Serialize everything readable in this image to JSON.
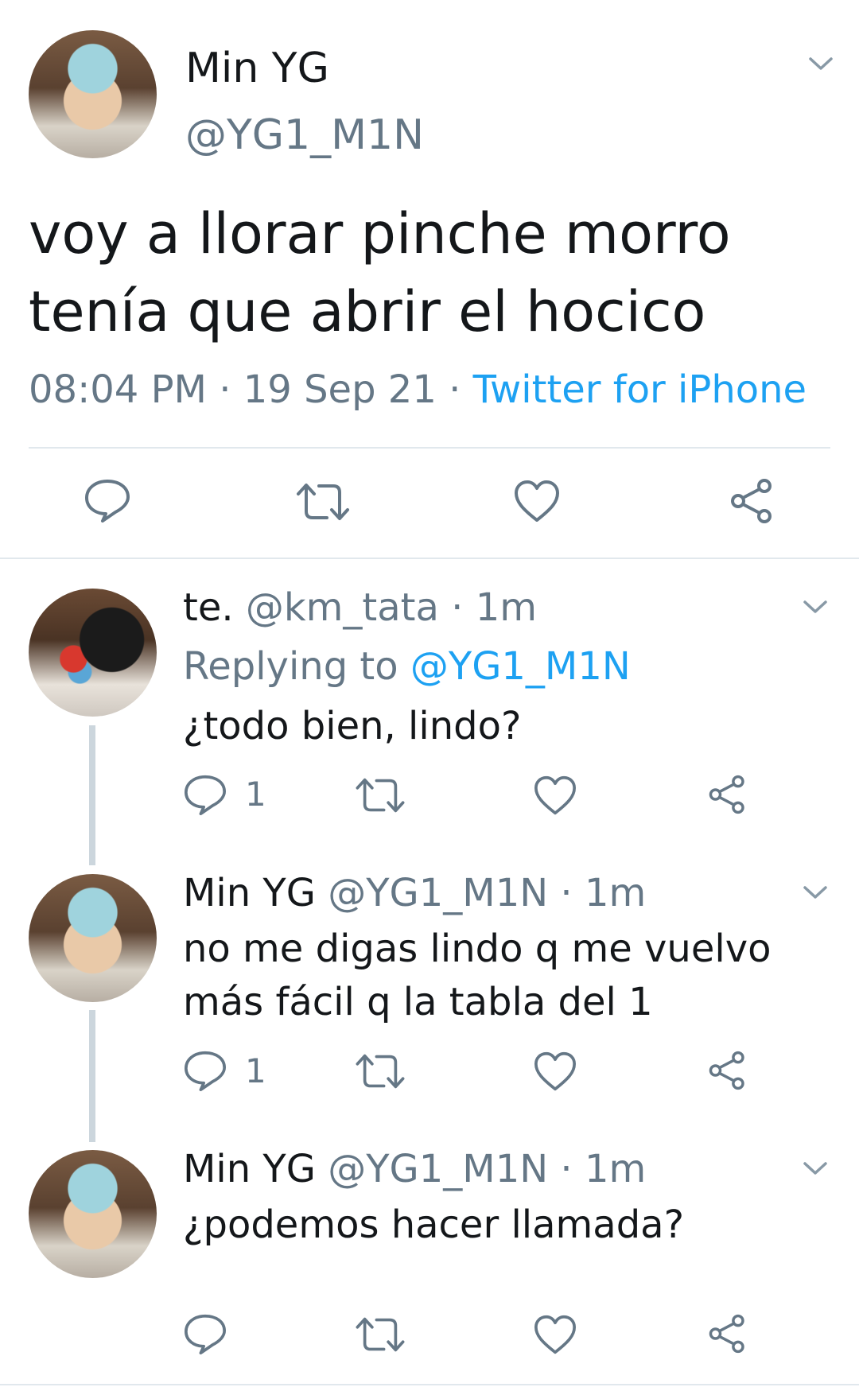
{
  "main_tweet": {
    "display_name": "Min YG",
    "handle": "@YG1_M1N",
    "text_line1": "voy a llorar pinche morro",
    "text_line2": "tenía que abrir el hocico",
    "time": "08:04 PM",
    "date": "19 Sep 21",
    "source": "Twitter for iPhone",
    "separator": " · "
  },
  "replies": [
    {
      "display_name": "te.",
      "handle": "@km_tata",
      "age": "1m",
      "replying_label": "Replying to",
      "replying_to": "@YG1_M1N",
      "text_line1": "¿todo bien, lindo?",
      "reply_count": "1"
    },
    {
      "display_name": "Min YG",
      "handle": "@YG1_M1N",
      "age": "1m",
      "text_line1": "no me digas lindo q me vuelvo",
      "text_line2": "más fácil q la tabla del 1",
      "reply_count": "1"
    },
    {
      "display_name": "Min YG",
      "handle": "@YG1_M1N",
      "age": "1m",
      "text_line1": "¿podemos hacer llamada?",
      "reply_count": ""
    }
  ],
  "colors": {
    "text": "#14171a",
    "secondary": "#657786",
    "link": "#1da1f2",
    "icon": "#657786",
    "divider": "#e1e8ed",
    "thread_line": "#ccd6dd"
  },
  "icons": [
    "chevron-down-icon",
    "reply-icon",
    "retweet-icon",
    "like-icon",
    "share-icon"
  ]
}
